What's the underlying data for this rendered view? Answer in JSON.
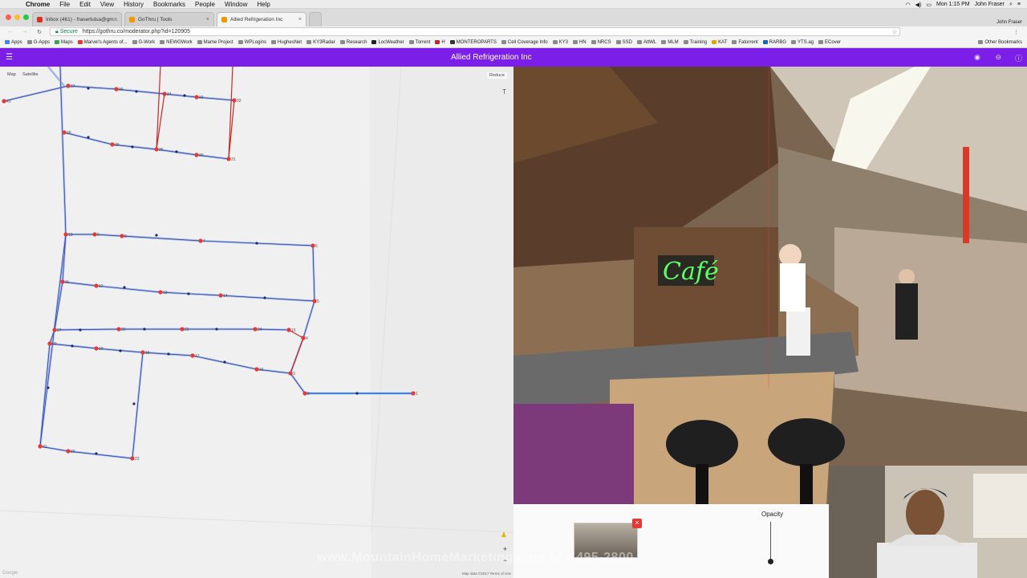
{
  "menubar": {
    "app": "Chrome",
    "items": [
      "File",
      "Edit",
      "View",
      "History",
      "Bookmarks",
      "People",
      "Window",
      "Help"
    ],
    "clock": "Mon 1:15 PM",
    "user": "John Fraser"
  },
  "tabs": [
    {
      "label": "Inbox (461) - frasertulsa@gm...",
      "active": false
    },
    {
      "label": "GoThru | Tools",
      "active": false
    },
    {
      "label": "Allied Refrigeration Inc",
      "active": true
    }
  ],
  "profile_name": "John Fraser",
  "address": {
    "secure_label": "Secure",
    "url": "https://gothru.co/moderator.php?id=120905"
  },
  "bookmarks": [
    "Apps",
    "G-Apps",
    "Maps",
    "Marvel's Agents of...",
    "G-Work",
    "NEWGWork",
    "Mame Project",
    "WPLogins",
    "HughesNet",
    "KY3Radar",
    "Research",
    "LocWeather",
    "Torrent",
    "H",
    "MONTEROPARTS",
    "Cell Coverage Info",
    "KY3",
    "HN",
    "NRCS",
    "SSD",
    "AttWL",
    "MLM",
    "Training",
    "KAT",
    "Fatorrent",
    "RARBG",
    "YTS.ag",
    "ECover"
  ],
  "other_bookmarks": "Other Bookmarks",
  "app": {
    "title": "Allied Refrigeration Inc",
    "accent": "#7b1fe8"
  },
  "map": {
    "type_map": "Map",
    "type_satellite": "Satellite",
    "reduce_label": "Reduce",
    "tool_label": "T",
    "zoom_in": "+",
    "zoom_out": "−",
    "google_label": "Google",
    "terms": "Map data ©2017   Terms of Use",
    "node_labels": [
      "43",
      "37",
      "36",
      "34",
      "33",
      "32",
      "29",
      "28",
      "35",
      "30",
      "31",
      "10",
      "9",
      "8",
      "7",
      "6",
      "11",
      "12",
      "13",
      "14",
      "5",
      "27",
      "26",
      "25",
      "24",
      "15",
      "4",
      "20",
      "19",
      "18",
      "17",
      "16",
      "3",
      "2",
      "1",
      "21",
      "22",
      "23"
    ]
  },
  "bottom": {
    "opacity_label": "Opacity",
    "opacity_value": 0.0,
    "close_icon": "×"
  },
  "watermark": "www.MountainHomeMarketing.com  870-495-2800"
}
